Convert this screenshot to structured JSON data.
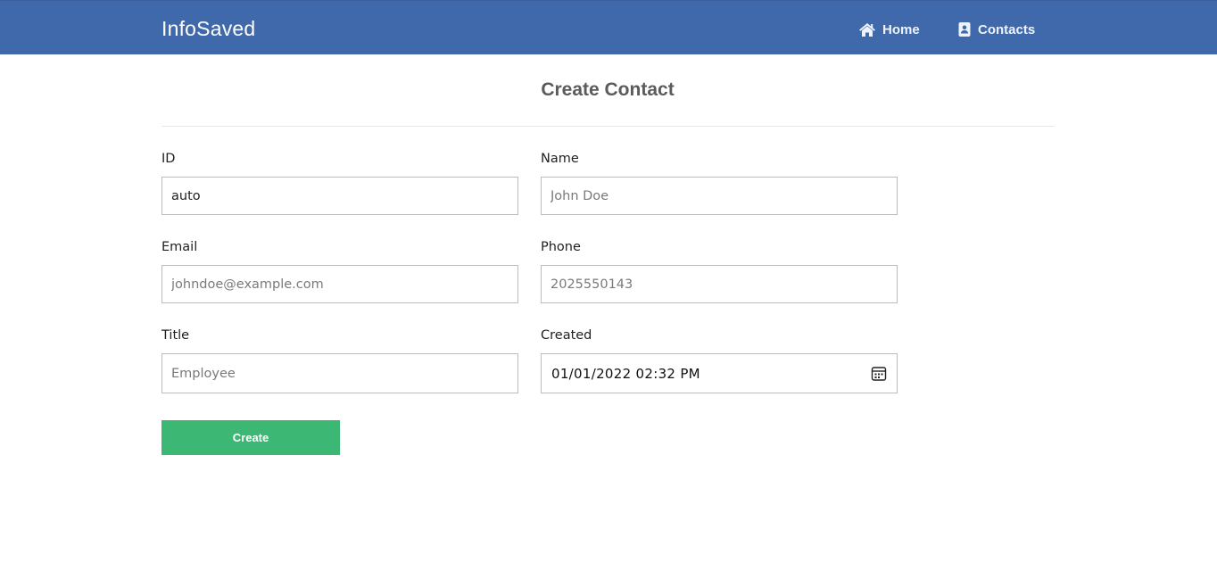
{
  "navbar": {
    "brand": "InfoSaved",
    "links": [
      {
        "label": "Home",
        "icon": "home-icon"
      },
      {
        "label": "Contacts",
        "icon": "address-book-icon"
      }
    ],
    "background": "#4069ab"
  },
  "form": {
    "title": "Create Contact",
    "fields": {
      "id": {
        "label": "ID",
        "value": "auto"
      },
      "name": {
        "label": "Name",
        "placeholder": "John Doe"
      },
      "email": {
        "label": "Email",
        "placeholder": "johndoe@example.com"
      },
      "phone": {
        "label": "Phone",
        "placeholder": "2025550143"
      },
      "title": {
        "label": "Title",
        "placeholder": "Employee"
      },
      "created": {
        "label": "Created",
        "value": "01/01/2022 02:32 PM",
        "icon": "calendar-icon"
      }
    },
    "submit_label": "Create",
    "submit_color": "#3cb874"
  }
}
